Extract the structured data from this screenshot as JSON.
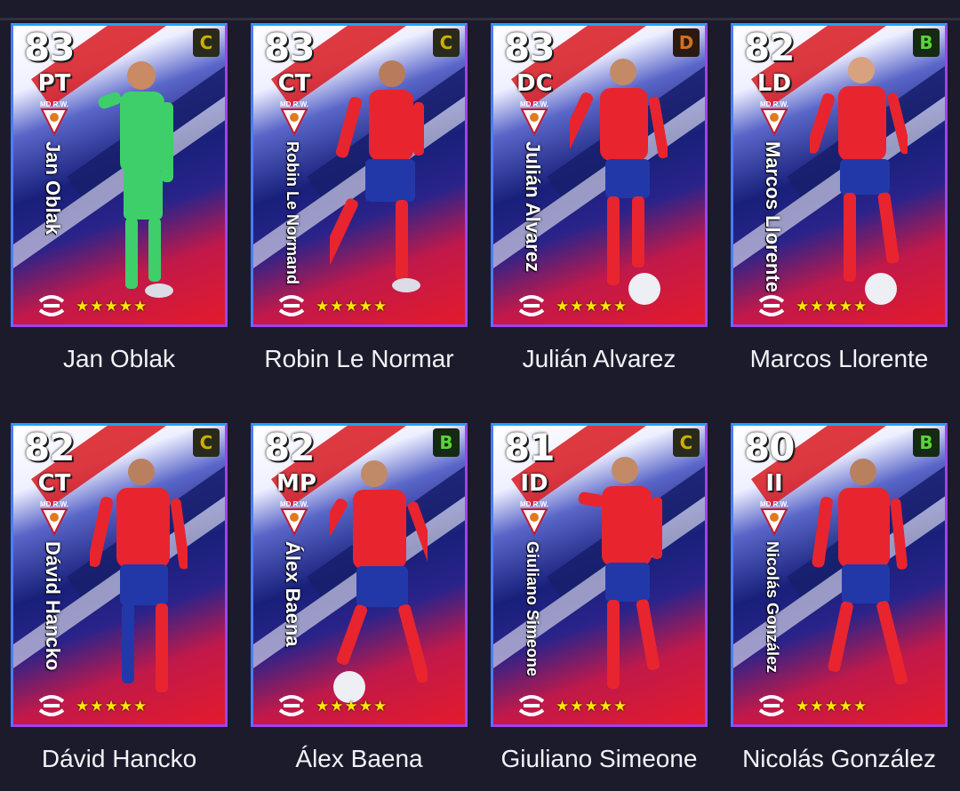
{
  "players": [
    {
      "rating": "83",
      "position": "PT",
      "grade": "C",
      "grade_color": "#c9b000",
      "card_name": "Jan Oblak",
      "label": "Jan Oblak",
      "kit": "keeper",
      "stars": "★★★★★"
    },
    {
      "rating": "83",
      "position": "CT",
      "grade": "C",
      "grade_color": "#c9b000",
      "card_name": "Robin Le Normand",
      "label": "Robin Le Normar",
      "kit": "outfield",
      "stars": "★★★★★"
    },
    {
      "rating": "83",
      "position": "DC",
      "grade": "D",
      "grade_color": "#d2701e",
      "card_name": "Julián Alvarez",
      "label": "Julián Alvarez",
      "kit": "outfield",
      "stars": "★★★★★"
    },
    {
      "rating": "82",
      "position": "LD",
      "grade": "B",
      "grade_color": "#5bd13a",
      "card_name": "Marcos Llorente",
      "label": "Marcos Llorente",
      "kit": "outfield",
      "stars": "★★★★★"
    },
    {
      "rating": "82",
      "position": "CT",
      "grade": "C",
      "grade_color": "#c9b000",
      "card_name": "Dávid Hancko",
      "label": "Dávid Hancko",
      "kit": "outfield",
      "stars": "★★★★★"
    },
    {
      "rating": "82",
      "position": "MP",
      "grade": "B",
      "grade_color": "#5bd13a",
      "card_name": "Álex Baena",
      "label": "Álex Baena",
      "kit": "outfield",
      "stars": "★★★★★"
    },
    {
      "rating": "81",
      "position": "ID",
      "grade": "C",
      "grade_color": "#c9b000",
      "card_name": "Giuliano Simeone",
      "label": "Giuliano Simeone",
      "kit": "outfield",
      "stars": "★★★★★"
    },
    {
      "rating": "80",
      "position": "II",
      "grade": "B",
      "grade_color": "#5bd13a",
      "card_name": "Nicolás González",
      "label": "Nicolás González",
      "kit": "outfield",
      "stars": "★★★★★"
    }
  ],
  "crest_text": "MD R.W.",
  "colors": {
    "background": "#1b1b2b",
    "card_border": "#9a44f0",
    "star": "#ffe600",
    "shirt": "#e8242f",
    "shorts": "#2338a8",
    "keeper": "#3ecf6a"
  }
}
